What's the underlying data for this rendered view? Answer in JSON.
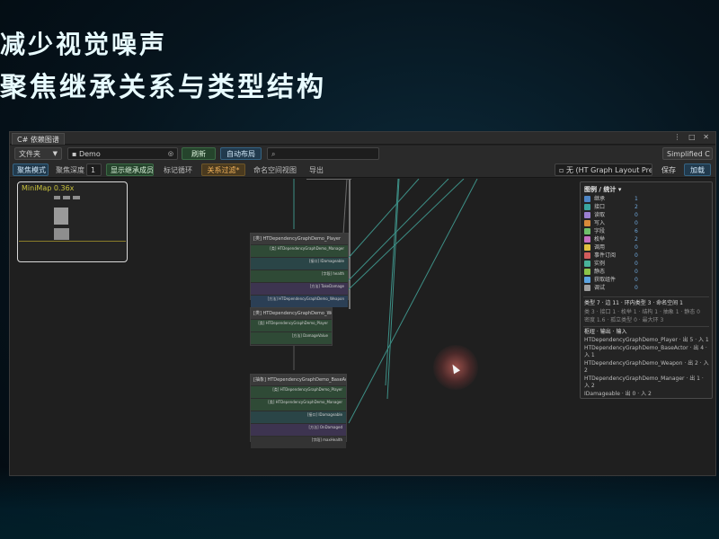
{
  "slide": {
    "title_line1": "减少视觉噪声",
    "title_line2": "聚焦继承关系与类型结构"
  },
  "window": {
    "tab_title": "C# 依赖图谱",
    "titlebar_icons": "⋮ □ ✕"
  },
  "toolbar1": {
    "scope_select": "文件夹",
    "folder_value": "Demo",
    "refresh": "刷新",
    "auto_layout": "自动布局",
    "search_placeholder": "",
    "mode_select": "Simplified C"
  },
  "toolbar2": {
    "focus_mode": "聚焦模式",
    "focus_depth_label": "聚焦深度",
    "focus_depth_value": "1",
    "show_inherit": "显示继承成员",
    "mark_cycles": "标记循环",
    "relation_filter": "关系过滤*",
    "namespace_view": "命名空间视图",
    "export": "导出",
    "layout_asset": "无 (HT Graph Layout Prese",
    "save": "保存",
    "load": "加载"
  },
  "minimap": {
    "label": "MiniMap  0.36x"
  },
  "nodes": [
    {
      "title": "[类] HTDependencyGraphDemo_Player",
      "rows": [
        {
          "text": "[类] HTDependencyGraphDemo_Manager",
          "tone": "green"
        },
        {
          "text": "[接口] IDamageable",
          "tone": "teal"
        },
        {
          "text": "[字段] health",
          "tone": "green"
        },
        {
          "text": "[方法] TakeDamage",
          "tone": "purple"
        },
        {
          "text": "[方法] HTDependencyGraphDemo_Weapon",
          "tone": "blue"
        }
      ]
    },
    {
      "title": "[类] HTDependencyGraphDemo_Weapon",
      "rows": [
        {
          "text": "[类] HTDependencyGraphDemo_Player",
          "tone": "green"
        },
        {
          "text": "[方法] DamageValue",
          "tone": "green"
        }
      ]
    },
    {
      "title": "[抽象] HTDependencyGraphDemo_BaseActor",
      "rows": [
        {
          "text": "[类] HTDependencyGraphDemo_Player",
          "tone": "green"
        },
        {
          "text": "[类] HTDependencyGraphDemo_Manager",
          "tone": "green"
        },
        {
          "text": "[接口] IDamageable",
          "tone": "teal"
        },
        {
          "text": "[方法] OnDamaged",
          "tone": "purple"
        },
        {
          "text": "[字段] maxHealth",
          "tone": "dark"
        }
      ]
    }
  ],
  "legend": {
    "title": "图例 / 统计 ▾",
    "items": [
      {
        "label": "继承",
        "value": "1",
        "color": "#4e86c6"
      },
      {
        "label": "接口",
        "value": "2",
        "color": "#3aa6a0"
      },
      {
        "label": "读取",
        "value": "0",
        "color": "#9a7fd1"
      },
      {
        "label": "写入",
        "value": "0",
        "color": "#d98a3a"
      },
      {
        "label": "字段",
        "value": "6",
        "color": "#6fbf6a"
      },
      {
        "label": "枚举",
        "value": "2",
        "color": "#c56fc0"
      },
      {
        "label": "调用",
        "value": "0",
        "color": "#e0c040"
      },
      {
        "label": "事件订阅",
        "value": "0",
        "color": "#d25c5c"
      },
      {
        "label": "实例",
        "value": "0",
        "color": "#49b39a"
      },
      {
        "label": "静态",
        "value": "0",
        "color": "#8bc34a"
      },
      {
        "label": "获取组件",
        "value": "0",
        "color": "#5ba3e0"
      },
      {
        "label": "调试",
        "value": "0",
        "color": "#9e9e9e"
      }
    ],
    "summary1": "类型 7 · 边 11 · 环内类型 3 · 命名空间 1",
    "summary2": "类 3 · 接口 1 · 枚举 1 · 结构 1 · 抽象 1 · 静态 0",
    "summary3": "密度 1.6 · 孤立类型 0 · 最大环 3",
    "section_title": "枢纽 · 输出 · 输入",
    "hubs": [
      "HTDependencyGraphDemo_Player · 出 5 · 入 1",
      "HTDependencyGraphDemo_BaseActor · 出 4 · 入 1",
      "HTDependencyGraphDemo_Weapon · 出 2 · 入 2",
      "HTDependencyGraphDemo_Manager · 出 1 · 入 2",
      "IDamageable · 出 0 · 入 2"
    ]
  }
}
